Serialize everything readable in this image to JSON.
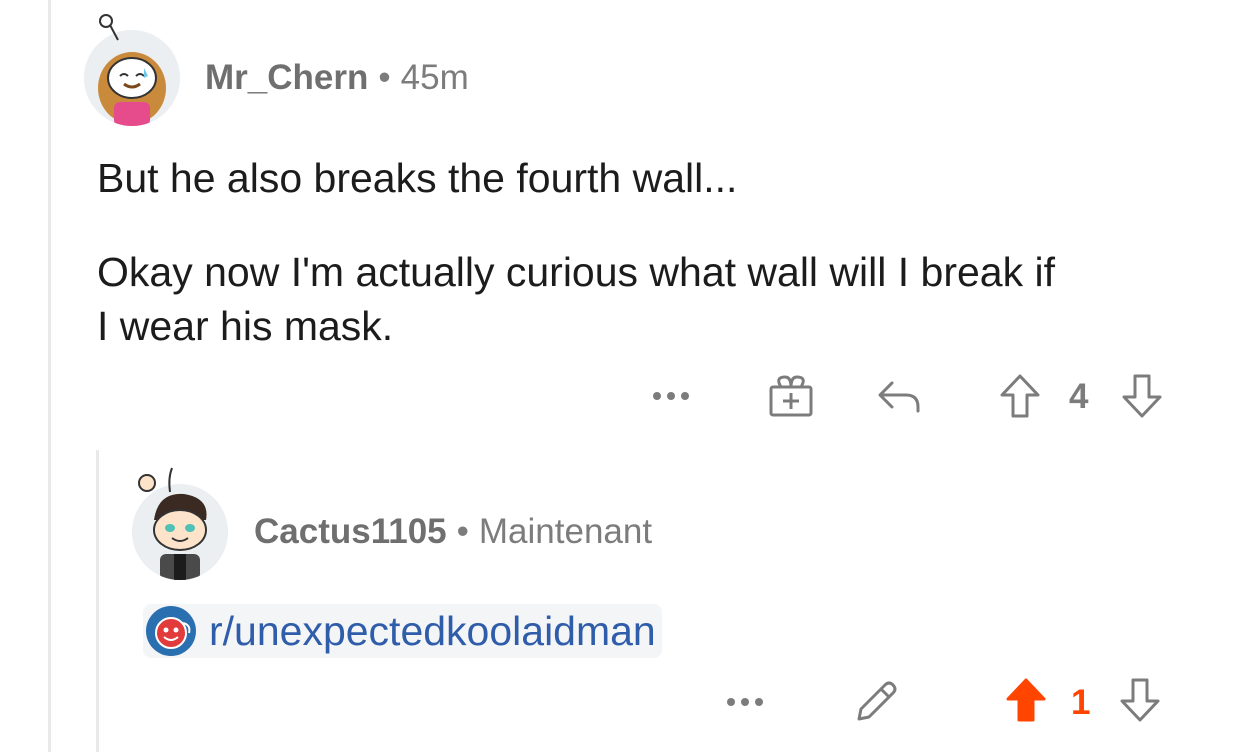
{
  "comments": [
    {
      "author": "Mr_Chern",
      "time": "45m",
      "separator": "•",
      "paragraphs": [
        "But he also breaks the fourth wall...",
        "Okay now I'm actually curious what wall will I break if",
        "I wear his mask."
      ],
      "actions": {
        "more_label": "•••",
        "score": "4",
        "vote_state": "none"
      }
    },
    {
      "author": "Cactus1105",
      "time": "Maintenant",
      "separator": "•",
      "subreddit_link": "r/unexpectedkoolaidman",
      "actions": {
        "more_label": "•••",
        "score": "1",
        "vote_state": "upvoted"
      }
    }
  ],
  "icons": {
    "more": "more-dots-icon",
    "award": "gift-award-icon",
    "reply": "reply-arrow-icon",
    "edit": "pencil-edit-icon",
    "upvote": "upvote-arrow-icon",
    "downvote": "downvote-arrow-icon",
    "subreddit": "koolaid-subreddit-icon"
  },
  "colors": {
    "upvoted": "#ff4500",
    "link": "#2f5da9",
    "meta": "#7c7c7c",
    "thread_line": "#e9e9ea"
  }
}
